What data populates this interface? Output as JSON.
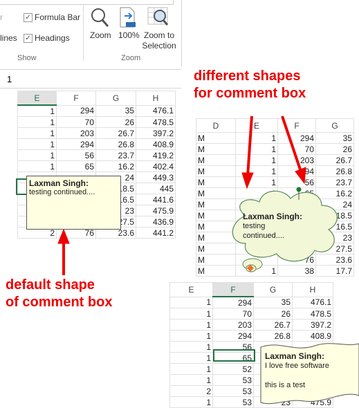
{
  "ribbon": {
    "partial_label_top": "r",
    "partial_label_lines": "lines",
    "formula_bar": "Formula Bar",
    "headings": "Headings",
    "show_group": "Show",
    "zoom": "Zoom",
    "zoom_100": "100%",
    "zoom_to_selection": "Zoom to Selection",
    "zoom_group": "Zoom",
    "formula_bar_checked": true,
    "headings_checked": true
  },
  "formula_bar": {
    "value": "1"
  },
  "sheet1": {
    "headers": [
      "E",
      "F",
      "G",
      "H"
    ],
    "selected_header": "E",
    "rows": [
      [
        "1",
        "294",
        "35",
        "476.1"
      ],
      [
        "1",
        "70",
        "26",
        "478.5"
      ],
      [
        "1",
        "203",
        "26.7",
        "397.2"
      ],
      [
        "1",
        "294",
        "26.8",
        "408.9"
      ],
      [
        "1",
        "56",
        "23.7",
        "419.2"
      ],
      [
        "1",
        "65",
        "16.2",
        "402.4"
      ],
      [
        "",
        "",
        "24",
        "449.3"
      ],
      [
        "",
        "",
        "18.5",
        "445"
      ],
      [
        "",
        "",
        "16.5",
        "441.6"
      ],
      [
        "",
        "",
        "23",
        "475.9"
      ],
      [
        "",
        "",
        "27.5",
        "436.9"
      ],
      [
        "2",
        "76",
        "23.6",
        "441.2"
      ]
    ],
    "comment": {
      "author": "Laxman Singh:",
      "text": "testing continued...."
    }
  },
  "sheet2": {
    "headers": [
      "D",
      "E",
      "F",
      "G"
    ],
    "rows": [
      [
        "M",
        "1",
        "294",
        "35"
      ],
      [
        "M",
        "1",
        "70",
        "26"
      ],
      [
        "M",
        "1",
        "203",
        "26.7"
      ],
      [
        "M",
        "1",
        "294",
        "26.8"
      ],
      [
        "M",
        "1",
        "56",
        "23.7"
      ],
      [
        "M",
        "1",
        "65",
        "16.2"
      ],
      [
        "M",
        "",
        "",
        "24"
      ],
      [
        "M",
        "",
        "",
        "18.5"
      ],
      [
        "M",
        "",
        "",
        "16.5"
      ],
      [
        "M",
        "",
        "",
        "23"
      ],
      [
        "M",
        "",
        "",
        "27.5"
      ],
      [
        "M",
        "",
        "76",
        "23.6"
      ],
      [
        "M",
        "1",
        "38",
        "17.7"
      ]
    ],
    "comment": {
      "author": "Laxman Singh:",
      "line1": "testing",
      "line2": "continued...."
    }
  },
  "sheet3": {
    "headers": [
      "E",
      "F",
      "G",
      "H"
    ],
    "selected_header": "F",
    "rows": [
      [
        "1",
        "294",
        "35",
        "476.1"
      ],
      [
        "1",
        "70",
        "26",
        "478.5"
      ],
      [
        "1",
        "203",
        "26.7",
        "397.2"
      ],
      [
        "1",
        "294",
        "26.8",
        "408.9"
      ],
      [
        "1",
        "56",
        "",
        ""
      ],
      [
        "1",
        "65",
        "",
        ""
      ],
      [
        "1",
        "52",
        "",
        ""
      ],
      [
        "1",
        "53",
        "",
        ""
      ],
      [
        "2",
        "53",
        "",
        ""
      ],
      [
        "1",
        "53",
        "23",
        "475.9"
      ]
    ],
    "comment": {
      "author": "Laxman Singh:",
      "line1": "I love free software",
      "line2": "this is a test"
    }
  },
  "annotations": {
    "different_line1": "different shapes",
    "different_line2": "for comment box",
    "default_line1": "default shape",
    "default_line2": "of comment box",
    "color": "#ee0000"
  }
}
